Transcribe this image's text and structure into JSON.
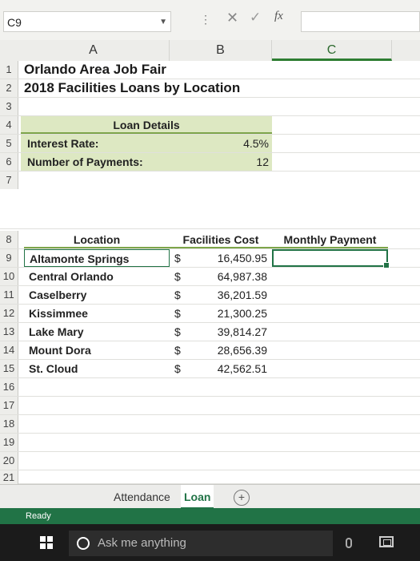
{
  "name_box": {
    "value": "C9"
  },
  "formula_bar": {
    "fx_label": "fx",
    "value": ""
  },
  "columns": [
    "A",
    "B",
    "C"
  ],
  "rows": [
    "1",
    "2",
    "3",
    "4",
    "5",
    "6",
    "7",
    "8",
    "9",
    "10",
    "11",
    "12",
    "13",
    "14",
    "15",
    "16",
    "17",
    "18",
    "19",
    "20",
    "21"
  ],
  "title": "Orlando Area Job Fair",
  "subtitle": "2018 Facilities Loans by Location",
  "loan_details": {
    "header": "Loan Details",
    "interest_label": "Interest Rate:",
    "interest_value": "4.5%",
    "payments_label": "Number of Payments:",
    "payments_value": "12"
  },
  "table": {
    "headers": {
      "location": "Location",
      "cost": "Facilities Cost",
      "payment": "Monthly Payment"
    },
    "currency_symbol": "$",
    "locations": [
      {
        "name": "Altamonte Springs",
        "cost": "16,450.95"
      },
      {
        "name": "Central Orlando",
        "cost": "64,987.38"
      },
      {
        "name": "Caselberry",
        "cost": "36,201.59"
      },
      {
        "name": "Kissimmee",
        "cost": "21,300.25"
      },
      {
        "name": "Lake Mary",
        "cost": "39,814.27"
      },
      {
        "name": "Mount Dora",
        "cost": "28,656.39"
      },
      {
        "name": "St. Cloud",
        "cost": "42,562.51"
      }
    ]
  },
  "sheet_tabs": [
    "Attendance",
    "Loan"
  ],
  "active_tab": "Loan",
  "status": "Ready",
  "taskbar": {
    "search_placeholder": "Ask me anything"
  },
  "colors": {
    "excel_green": "#217346",
    "highlight": "#dde8c2"
  }
}
